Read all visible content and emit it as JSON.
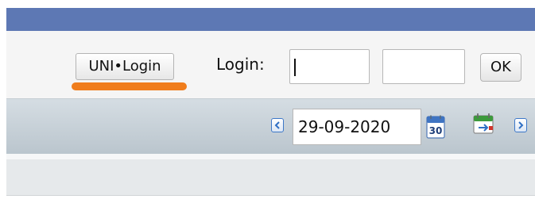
{
  "header": {
    "uni_login_label": "UNI•Login",
    "login_label": "Login:",
    "username_value": "",
    "password_value": "",
    "ok_label": "OK"
  },
  "date_nav": {
    "date_value": "29-09-2020",
    "calendar_day": "30"
  },
  "colors": {
    "topbar": "#5d78b4",
    "highlight": "#f07d1c",
    "nav_arrow": "#3d78c8"
  },
  "icons": [
    "prev-arrow-icon",
    "calendar-icon",
    "calendar-go-icon",
    "next-arrow-icon"
  ]
}
